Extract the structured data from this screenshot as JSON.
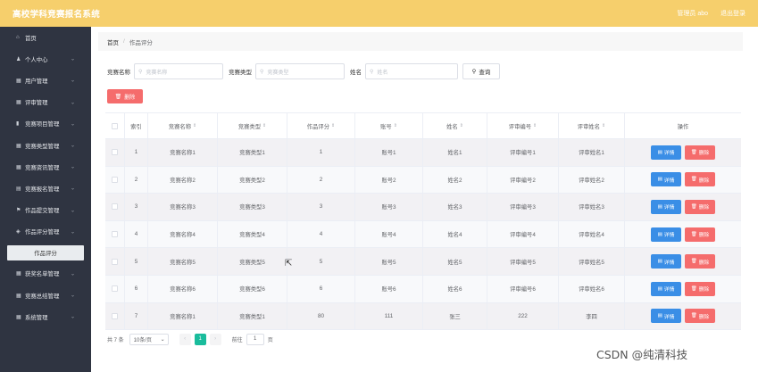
{
  "header": {
    "title": "高校学科竞赛报名系统",
    "user_label": "管理员 abo",
    "logout_label": "退出登录"
  },
  "sidebar": {
    "items": [
      {
        "icon": "home-icon",
        "glyph": "⌂",
        "label": "首页",
        "expandable": false
      },
      {
        "icon": "user-icon",
        "glyph": "♟",
        "label": "个人中心",
        "expandable": true
      },
      {
        "icon": "grid-icon",
        "glyph": "▦",
        "label": "用户管理",
        "expandable": true
      },
      {
        "icon": "grid-icon",
        "glyph": "▦",
        "label": "评审管理",
        "expandable": true
      },
      {
        "icon": "bar-chart-icon",
        "glyph": "▮",
        "label": "竞赛项目管理",
        "expandable": true
      },
      {
        "icon": "grid-icon",
        "glyph": "▦",
        "label": "竞赛类型管理",
        "expandable": true
      },
      {
        "icon": "grid-icon",
        "glyph": "▦",
        "label": "竞赛资讯管理",
        "expandable": true
      },
      {
        "icon": "doc-icon",
        "glyph": "▤",
        "label": "竞赛报名管理",
        "expandable": true
      },
      {
        "icon": "flag-icon",
        "glyph": "⚑",
        "label": "作品提交管理",
        "expandable": true
      },
      {
        "icon": "layers-icon",
        "glyph": "◈",
        "label": "作品评分管理",
        "expandable": true
      }
    ],
    "active_sub": "作品评分",
    "items_after": [
      {
        "icon": "grid-icon",
        "glyph": "▦",
        "label": "获奖名单管理",
        "expandable": true
      },
      {
        "icon": "grid-icon",
        "glyph": "▦",
        "label": "竞赛总结管理",
        "expandable": true
      },
      {
        "icon": "grid-icon",
        "glyph": "▦",
        "label": "系统管理",
        "expandable": true
      }
    ]
  },
  "breadcrumb": {
    "home": "首页",
    "separator": "/",
    "current": "作品评分"
  },
  "search": {
    "field1_label": "竞赛名称",
    "field1_placeholder": "竞赛名称",
    "field2_label": "竞赛类型",
    "field2_placeholder": "竞赛类型",
    "field3_label": "姓名",
    "field3_placeholder": "姓名",
    "query_label": "查询"
  },
  "actions": {
    "delete_label": "删除"
  },
  "table": {
    "headers": [
      "索引",
      "竞赛名称",
      "竞赛类型",
      "作品评分",
      "账号",
      "姓名",
      "评审编号",
      "评审姓名",
      "操作"
    ],
    "rows": [
      [
        "1",
        "竞赛名称1",
        "竞赛类型1",
        "1",
        "账号1",
        "姓名1",
        "评审编号1",
        "评审姓名1"
      ],
      [
        "2",
        "竞赛名称2",
        "竞赛类型2",
        "2",
        "账号2",
        "姓名2",
        "评审编号2",
        "评审姓名2"
      ],
      [
        "3",
        "竞赛名称3",
        "竞赛类型3",
        "3",
        "账号3",
        "姓名3",
        "评审编号3",
        "评审姓名3"
      ],
      [
        "4",
        "竞赛名称4",
        "竞赛类型4",
        "4",
        "账号4",
        "姓名4",
        "评审编号4",
        "评审姓名4"
      ],
      [
        "5",
        "竞赛名称5",
        "竞赛类型5",
        "5",
        "账号5",
        "姓名5",
        "评审编号5",
        "评审姓名5"
      ],
      [
        "6",
        "竞赛名称6",
        "竞赛类型6",
        "6",
        "账号6",
        "姓名6",
        "评审编号6",
        "评审姓名6"
      ],
      [
        "7",
        "竞赛名称1",
        "竞赛类型1",
        "80",
        "111",
        "张三",
        "222",
        "李四"
      ]
    ],
    "detail_label": "详情",
    "row_delete_label": "删除"
  },
  "pagination": {
    "total_label": "共 7 条",
    "page_size": "10条/页",
    "prev": "‹",
    "current_page": "1",
    "next": "›",
    "goto_label": "前往",
    "goto_value": "1",
    "page_suffix": "页"
  },
  "watermark": "CSDN @纯清科技",
  "colors": {
    "header_bg": "#f6cf6c",
    "sidebar_bg": "#2f3441",
    "danger": "#f56c6c",
    "primary": "#3a8ee6",
    "page_active": "#1abc9c"
  }
}
